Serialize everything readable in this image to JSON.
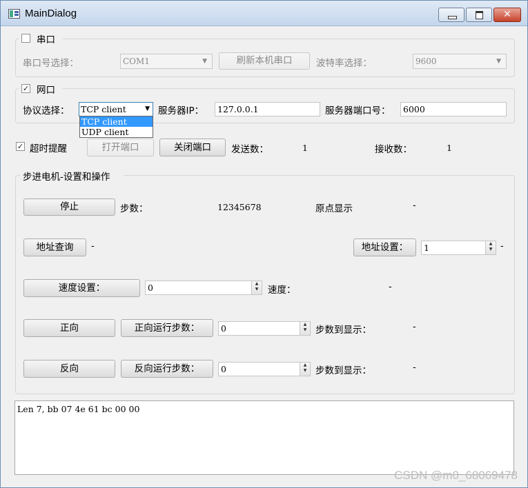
{
  "window": {
    "title": "MainDialog",
    "close_glyph": "✕"
  },
  "serial": {
    "group_label": "串口",
    "checked": false,
    "port_label": "串口号选择：",
    "port_value": "COM1",
    "refresh_button": "刷新本机串口",
    "baud_label": "波特率选择：",
    "baud_value": "9600"
  },
  "network": {
    "group_label": "网口",
    "checked": true,
    "protocol_label": "协议选择：",
    "protocol_value": "TCP client",
    "protocol_options": [
      "TCP client",
      "UDP client"
    ],
    "server_ip_label": "服务器IP：",
    "server_ip_value": "127.0.0.1",
    "server_port_label": "服务器端口号：",
    "server_port_value": "6000"
  },
  "controls": {
    "timeout_label": "超时提醒",
    "timeout_checked": true,
    "open_button": "打开端口",
    "close_button": "关闭端口",
    "send_label": "发送数：",
    "send_value": "1",
    "recv_label": "接收数：",
    "recv_value": "1"
  },
  "motor": {
    "group_label": "步进电机-设置和操作",
    "stop_button": "停止",
    "steps_label": "步数：",
    "steps_value": "12345678",
    "origin_label": "原点显示",
    "origin_value": "-",
    "addr_query_button": "地址查询",
    "addr_query_value": "-",
    "addr_set_button": "地址设置：",
    "addr_set_value": "1",
    "addr_set_result": "-",
    "speed_set_button": "速度设置：",
    "speed_set_value": "0",
    "speed_label": "速度：",
    "speed_value": "-",
    "forward_button": "正向",
    "forward_steps_button": "正向运行步数：",
    "forward_steps_value": "0",
    "forward_done_label": "步数到显示：",
    "forward_done_value": "-",
    "reverse_button": "反向",
    "reverse_steps_button": "反向运行步数：",
    "reverse_steps_value": "0",
    "reverse_done_label": "步数到显示：",
    "reverse_done_value": "-"
  },
  "log": {
    "text": "Len 7, bb 07 4e 61 bc 00 00"
  },
  "watermark": "CSDN @m0_68069478"
}
